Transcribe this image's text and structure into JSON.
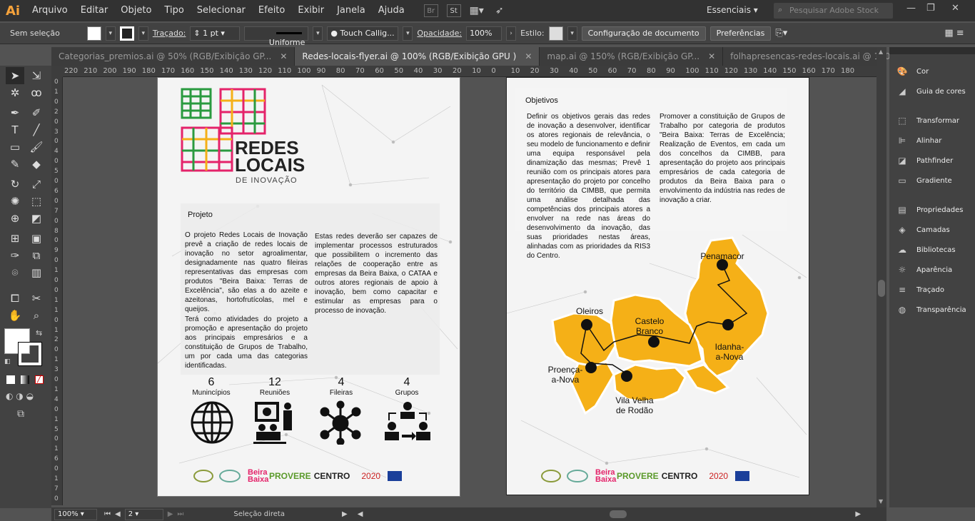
{
  "app": {
    "logo": "Ai"
  },
  "menu": [
    "Arquivo",
    "Editar",
    "Objeto",
    "Tipo",
    "Selecionar",
    "Efeito",
    "Exibir",
    "Janela",
    "Ajuda"
  ],
  "menubar_icons": {
    "br": "Br",
    "st": "St"
  },
  "workspace": "Essenciais",
  "search_placeholder": "Pesquisar Adobe Stock",
  "control": {
    "selection": "Sem seleção",
    "stroke_label": "Traçado:",
    "stroke_value": "1 pt",
    "profile": "Uniforme",
    "brush": "Touch Callig...",
    "opacity_label": "Opacidade:",
    "opacity_value": "100%",
    "style_label": "Estilo:",
    "doc_setup": "Configuração de documento",
    "prefs": "Preferências"
  },
  "tabs": [
    {
      "label": "Categorias_premios.ai @ 50% (RGB/Exibição GP...",
      "active": false
    },
    {
      "label": "Redes-locais-flyer.ai @ 100% (RGB/Exibição GPU )",
      "active": true
    },
    {
      "label": "map.ai @ 150% (RGB/Exibição GP...",
      "active": false
    },
    {
      "label": "folhapresencas-redes-locais.ai @ 100% (CMYK/Exibiç...",
      "active": false
    }
  ],
  "ruler_h": [
    "220",
    "210",
    "200",
    "190",
    "180",
    "170",
    "160",
    "150",
    "140",
    "130",
    "120",
    "110",
    "100",
    "90",
    "80",
    "70",
    "60",
    "50",
    "40",
    "30",
    "20",
    "10",
    "0",
    "10",
    "20",
    "30",
    "40",
    "50",
    "60",
    "70",
    "80",
    "90",
    "100",
    "110",
    "120",
    "130",
    "140",
    "150",
    "160",
    "170",
    "180"
  ],
  "ruler_v": [
    "0",
    "1",
    "0",
    "2",
    "0",
    "3",
    "0",
    "4",
    "0",
    "5",
    "0",
    "6",
    "0",
    "7",
    "0",
    "8",
    "0",
    "9",
    "0",
    "1",
    "0",
    "0",
    "1",
    "1",
    "0",
    "1",
    "2",
    "0",
    "1",
    "3",
    "0",
    "1",
    "4",
    "0",
    "1",
    "5",
    "0",
    "1",
    "6",
    "0",
    "1",
    "7",
    "0"
  ],
  "panels": [
    "Cor",
    "Guia de cores",
    "Transformar",
    "Alinhar",
    "Pathfinder",
    "Gradiente",
    "Propriedades",
    "Camadas",
    "Bibliotecas",
    "Aparência",
    "Traçado",
    "Transparência"
  ],
  "status": {
    "zoom": "100%",
    "page": "2",
    "tool": "Seleção direta"
  },
  "flyer": {
    "title1": "REDES",
    "title2": "LOCAIS",
    "subtitle": "DE INOVAÇÃO",
    "projeto_heading": "Projeto",
    "col1_p1": "O projeto Redes Locais de Inovação prevê a criação de redes locais de inovação no setor agroalimentar, designadamente nas quatro fileiras representativas das empresas com produtos \"Beira Baixa: Terras de Excelência\", são elas a do azeite e azeitonas, hortofrutícolas, mel e queijos.",
    "col1_p2": "Terá como atividades do projeto a promoção e apresentação do projeto aos principais empresários e a constituição de Grupos de Trabalho, um por cada uma das categorias identificadas.",
    "col2_p1": "Estas redes deverão ser capazes de implementar processos estruturados que possibilitem o incremento das relações de cooperação entre as empresas da Beira Baixa, o CATAA e outros atores regionais de apoio à inovação, bem como capacitar e estimular as empresas para o processo de inovação.",
    "stats": [
      {
        "n": "6",
        "label": "Munincípios"
      },
      {
        "n": "12",
        "label": "Reuniões"
      },
      {
        "n": "4",
        "label": "Fileiras"
      },
      {
        "n": "4",
        "label": "Grupos"
      }
    ],
    "objetivos_heading": "Objetivos",
    "obj_col1": "Definir os objetivos gerais das redes de inovação a desenvolver, identificar os atores regionais de relevância, o seu modelo de funcionamento e definir uma equipa responsável pela dinamização das mesmas; Prevê 1 reunião com os principais atores para apresentação do projeto por concelho do território da CIMBB, que permita uma análise detalhada das competências dos principais atores a envolver na rede nas áreas do desenvolvimento da inovação, das suas prioridades nestas áreas, alinhadas com as prioridades da RIS3 do Centro.",
    "obj_col2": "Promover a constituição de Grupos de Trabalho por categoria de produtos \"Beira Baixa: Terras de Excelência; Realização de Eventos, em cada um dos concelhos da CIMBB, para apresentação do projeto aos principais empresários de cada categoria de produtos da Beira Baixa para o envolvimento da indústria nas redes de inovação a criar.",
    "cities": [
      "Penamacor",
      "Oleiros",
      "Castelo Branco",
      "Idanha-a-Nova",
      "Proença-a-Nova",
      "Vila Velha de Rodão"
    ],
    "footer_logos": [
      "Beira Baixa",
      "PROVERE",
      "CENTRO",
      "2020"
    ],
    "map_color": "#f5b017"
  }
}
